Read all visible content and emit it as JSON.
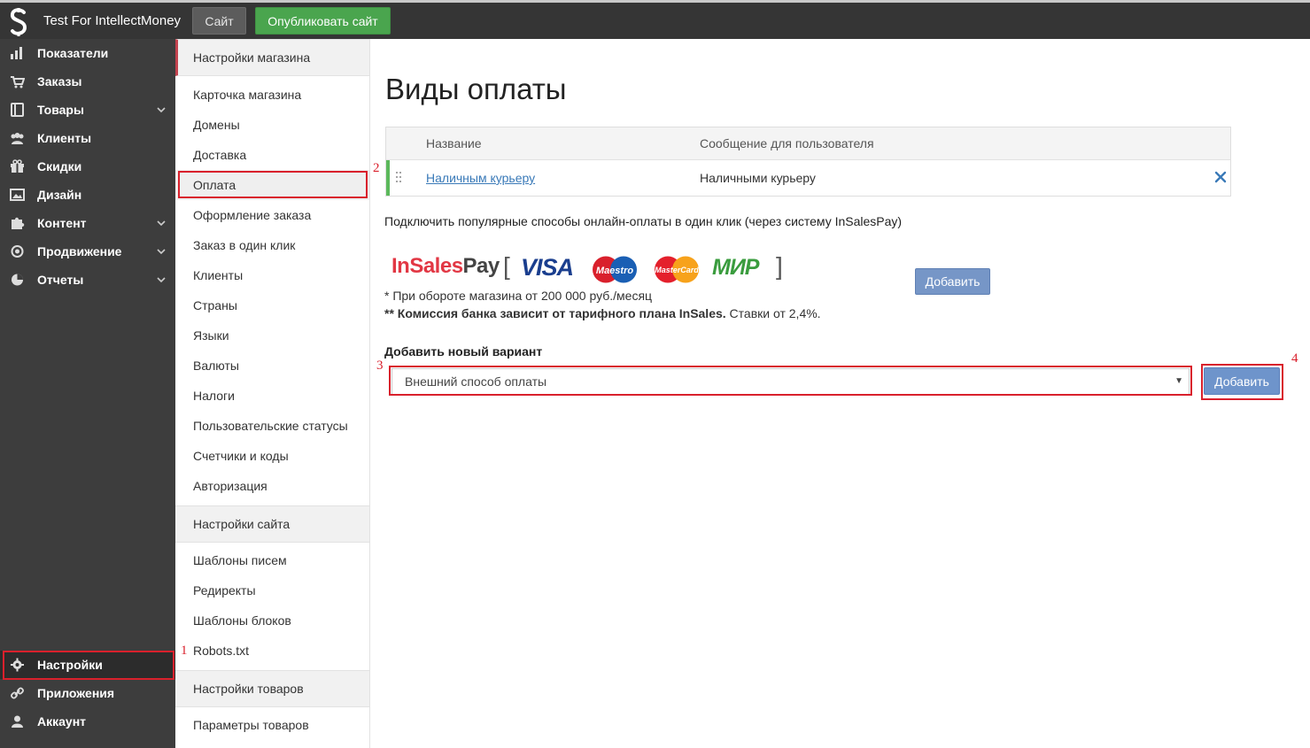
{
  "header": {
    "shop_name": "Test For IntellectMoney",
    "site_button": "Сайт",
    "publish_button": "Опубликовать сайт"
  },
  "sidebar": {
    "items": [
      {
        "label": "Показатели",
        "icon": "bar-chart-icon"
      },
      {
        "label": "Заказы",
        "icon": "cart-icon"
      },
      {
        "label": "Товары",
        "icon": "book-icon",
        "has_submenu": true
      },
      {
        "label": "Клиенты",
        "icon": "users-icon"
      },
      {
        "label": "Скидки",
        "icon": "gift-icon"
      },
      {
        "label": "Дизайн",
        "icon": "image-icon"
      },
      {
        "label": "Контент",
        "icon": "puzzle-icon",
        "has_submenu": true
      },
      {
        "label": "Продвижение",
        "icon": "target-icon",
        "has_submenu": true
      },
      {
        "label": "Отчеты",
        "icon": "pie-chart-icon",
        "has_submenu": true
      }
    ],
    "bottom_items": [
      {
        "label": "Настройки",
        "icon": "gear-icon",
        "active": true
      },
      {
        "label": "Приложения",
        "icon": "link-icon"
      },
      {
        "label": "Аккаунт",
        "icon": "user-icon"
      }
    ]
  },
  "settings_menu": {
    "shop_header": "Настройки магазина",
    "shop_items": [
      "Карточка магазина",
      "Домены",
      "Доставка",
      "Оплата",
      "Оформление заказа",
      "Заказ в один клик",
      "Клиенты",
      "Страны",
      "Языки",
      "Валюты",
      "Налоги",
      "Пользовательские статусы",
      "Счетчики и коды",
      "Авторизация"
    ],
    "site_header": "Настройки сайта",
    "site_items": [
      "Шаблоны писем",
      "Редиректы",
      "Шаблоны блоков",
      "Robots.txt"
    ],
    "products_header": "Настройки товаров",
    "products_items": [
      "Параметры товаров"
    ]
  },
  "main": {
    "title": "Виды оплаты",
    "table": {
      "columns": [
        "Название",
        "Сообщение для пользователя"
      ],
      "rows": [
        {
          "name": "Наличным курьеру",
          "message": "Наличными курьеру"
        }
      ]
    },
    "connect_text": "Подключить популярные способы онлайн-оплаты в один клик (через систему InSalesPay)",
    "logos": {
      "insales_a": "InSales",
      "insales_b": "Pay",
      "visa": "VISA",
      "maestro": "Maestro",
      "mastercard": "MasterCard",
      "mir": "МИР"
    },
    "add_button_1": "Добавить",
    "note_1": "* При обороте магазина от 200 000 руб./месяц",
    "note_2_bold": "** Комиссия банка зависит от тарифного плана InSales.",
    "note_2_rest": " Ставки от 2,4%.",
    "add_new_label": "Добавить новый вариант",
    "select_value": "Внешний способ оплаты",
    "add_button_2": "Добавить"
  },
  "annotations": [
    "1",
    "2",
    "3",
    "4"
  ],
  "colors": {
    "highlight": "#d9202c",
    "publish_green": "#4aa54e",
    "add_blue": "#6e94cb",
    "sidebar_dark": "#3d3d3d"
  }
}
